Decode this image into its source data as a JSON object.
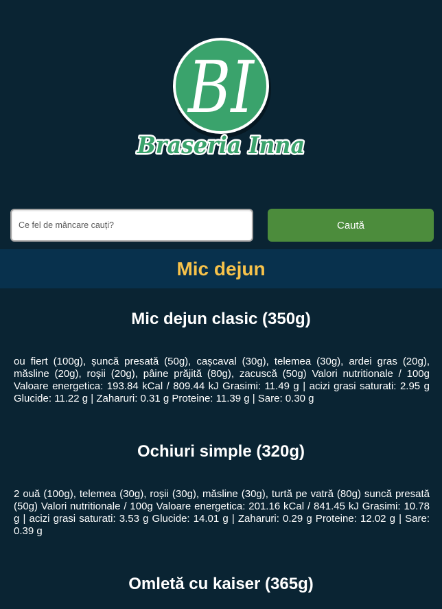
{
  "brand": {
    "monogram": "BI",
    "name": "Braseria Inna"
  },
  "search": {
    "placeholder": "Ce fel de mâncare cauți?",
    "value": "",
    "button_label": "Caută",
    "search_icon": "none"
  },
  "category": {
    "title": "Mic dejun",
    "items": [
      {
        "title": "Mic dejun clasic (350g)",
        "description": "ou fiert (100g), șuncă presată (50g), cașcaval (30g), telemea (30g), ardei gras (20g), măsline (20g), roșii (20g), pâine prăjită (80g), zacuscă (50g) Valori nutritionale / 100g Valoare energetica: 193.84 kCal / 809.44 kJ Grasimi: 11.49 g | acizi grasi saturati: 2.95 g Glucide: 11.22 g | Zaharuri: 0.31 g Proteine: 11.39 g | Sare: 0.30 g"
      },
      {
        "title": "Ochiuri simple (320g)",
        "description": "2 ouă (100g), telemea (30g), roșii (30g), măsline (30g), turtă pe vatră (80g) suncă presată (50g) Valori nutritionale / 100g Valoare energetica: 201.16 kCal / 841.45 kJ Grasimi: 10.78 g | acizi grasi saturati: 3.53 g Glucide: 14.01 g | Zaharuri: 0.29 g Proteine: 12.02 g | Sare: 0.39 g"
      },
      {
        "title": "Omletă cu kaiser (365g)"
      }
    ]
  },
  "colors": {
    "background": "#0a2433",
    "band": "#08314d",
    "accent": "#f7c24a",
    "button": "#4c8c3c",
    "logo_green": "#3aa36c"
  }
}
